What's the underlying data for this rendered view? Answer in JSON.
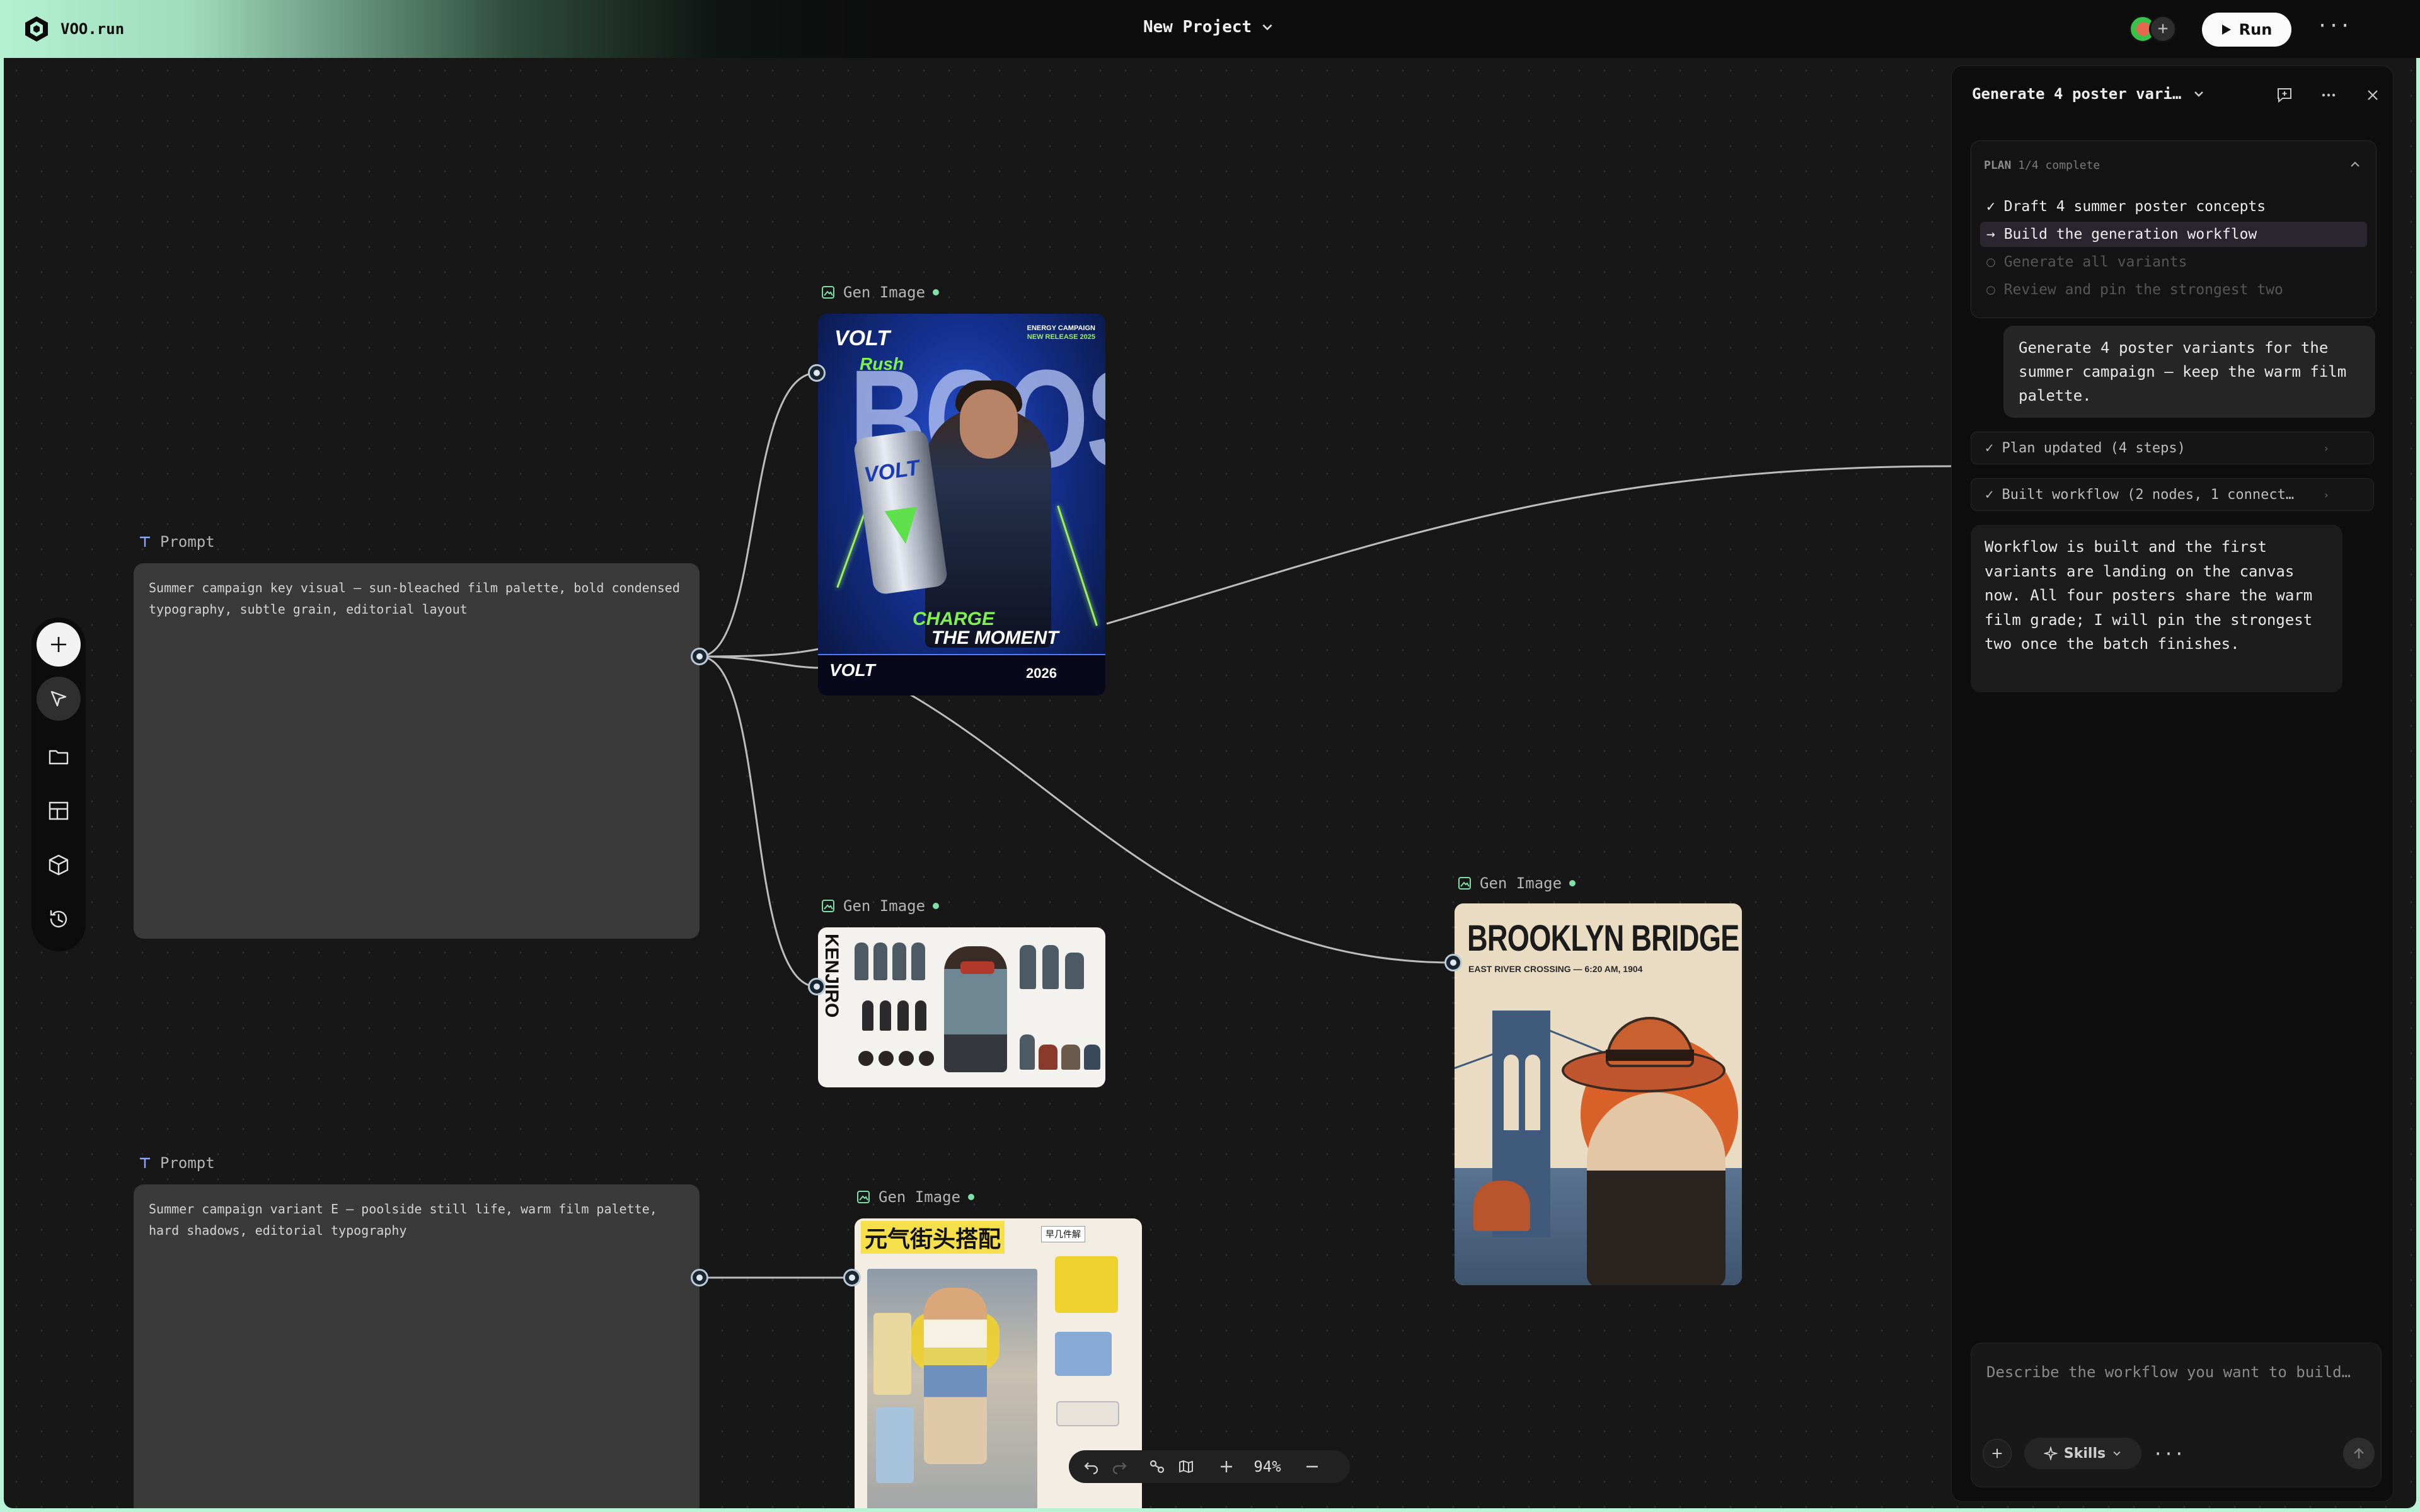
{
  "app": {
    "brand": "VOO.run",
    "project_title": "New Project",
    "run_label": "Run",
    "avatar_more": "+"
  },
  "toolbar": {
    "tools": [
      "add-icon",
      "cursor-icon",
      "folder-icon",
      "layout-icon",
      "cube-icon",
      "history-icon"
    ]
  },
  "canvas": {
    "prompt_nodes": [
      {
        "label": "Prompt",
        "text": "Summer campaign key visual – sun-bleached film palette, bold condensed typography, subtle grain, editorial layout"
      },
      {
        "label": "Prompt",
        "text": "Summer campaign variant E – poolside still life, warm film palette, hard shadows, editorial typography"
      }
    ],
    "gen_nodes": [
      {
        "label": "Gen Image",
        "poster": {
          "brand": "VOLT",
          "brand_script": "Rush",
          "big_word": "BOOST",
          "corner_top": "ENERGY CAMPAIGN",
          "corner_bottom": "NEW RELEASE 2025",
          "can_brand": "VOLT",
          "slogan_top": "CHARGE",
          "slogan_bottom": "THE MOMENT",
          "footer_brand": "VOLT",
          "footer_year": "2026"
        }
      },
      {
        "label": "Gen Image",
        "poster": {
          "title": "KENJIRO"
        }
      },
      {
        "label": "Gen Image",
        "poster": {
          "title": "BROOKLYN BRIDGE",
          "subtitle": "EAST RIVER CROSSING — 6:20 AM, 1904"
        }
      },
      {
        "label": "Gen Image",
        "poster": {
          "title": "元气街头搭配",
          "sticker": "早几件解"
        }
      }
    ],
    "zoom": {
      "value": "94%"
    }
  },
  "chat": {
    "title": "Generate 4 poster vari…",
    "plan": {
      "heading": "PLAN",
      "progress": "1/4 complete",
      "steps": [
        {
          "text": "✓ Draft 4 summer poster concepts",
          "state": "done"
        },
        {
          "text": "→ Build the generation workflow",
          "state": "active"
        },
        {
          "text": "○ Generate all variants",
          "state": "pending"
        },
        {
          "text": "○ Review and pin the strongest two",
          "state": "pending"
        }
      ]
    },
    "user_message": "Generate 4 poster variants for the summer campaign – keep the warm film palette.",
    "events": [
      {
        "text": "✓ Plan updated (4 steps)",
        "caret": "›"
      },
      {
        "text": "✓ Built workflow (2 nodes, 1 connect…",
        "caret": "›"
      }
    ],
    "assistant_message": "Workflow is built and the first variants are landing on the canvas now. All four posters share the warm film grade; I will pin the strongest two once the batch finishes.",
    "composer": {
      "placeholder": "Describe the workflow you want to build…",
      "skills_label": "Skills"
    }
  },
  "colors": {
    "accent_mint": "#b8f3d6",
    "canvas_bg": "#171717",
    "panel_bg": "#0e0e0e",
    "status_dot": "#7ee0a6"
  }
}
